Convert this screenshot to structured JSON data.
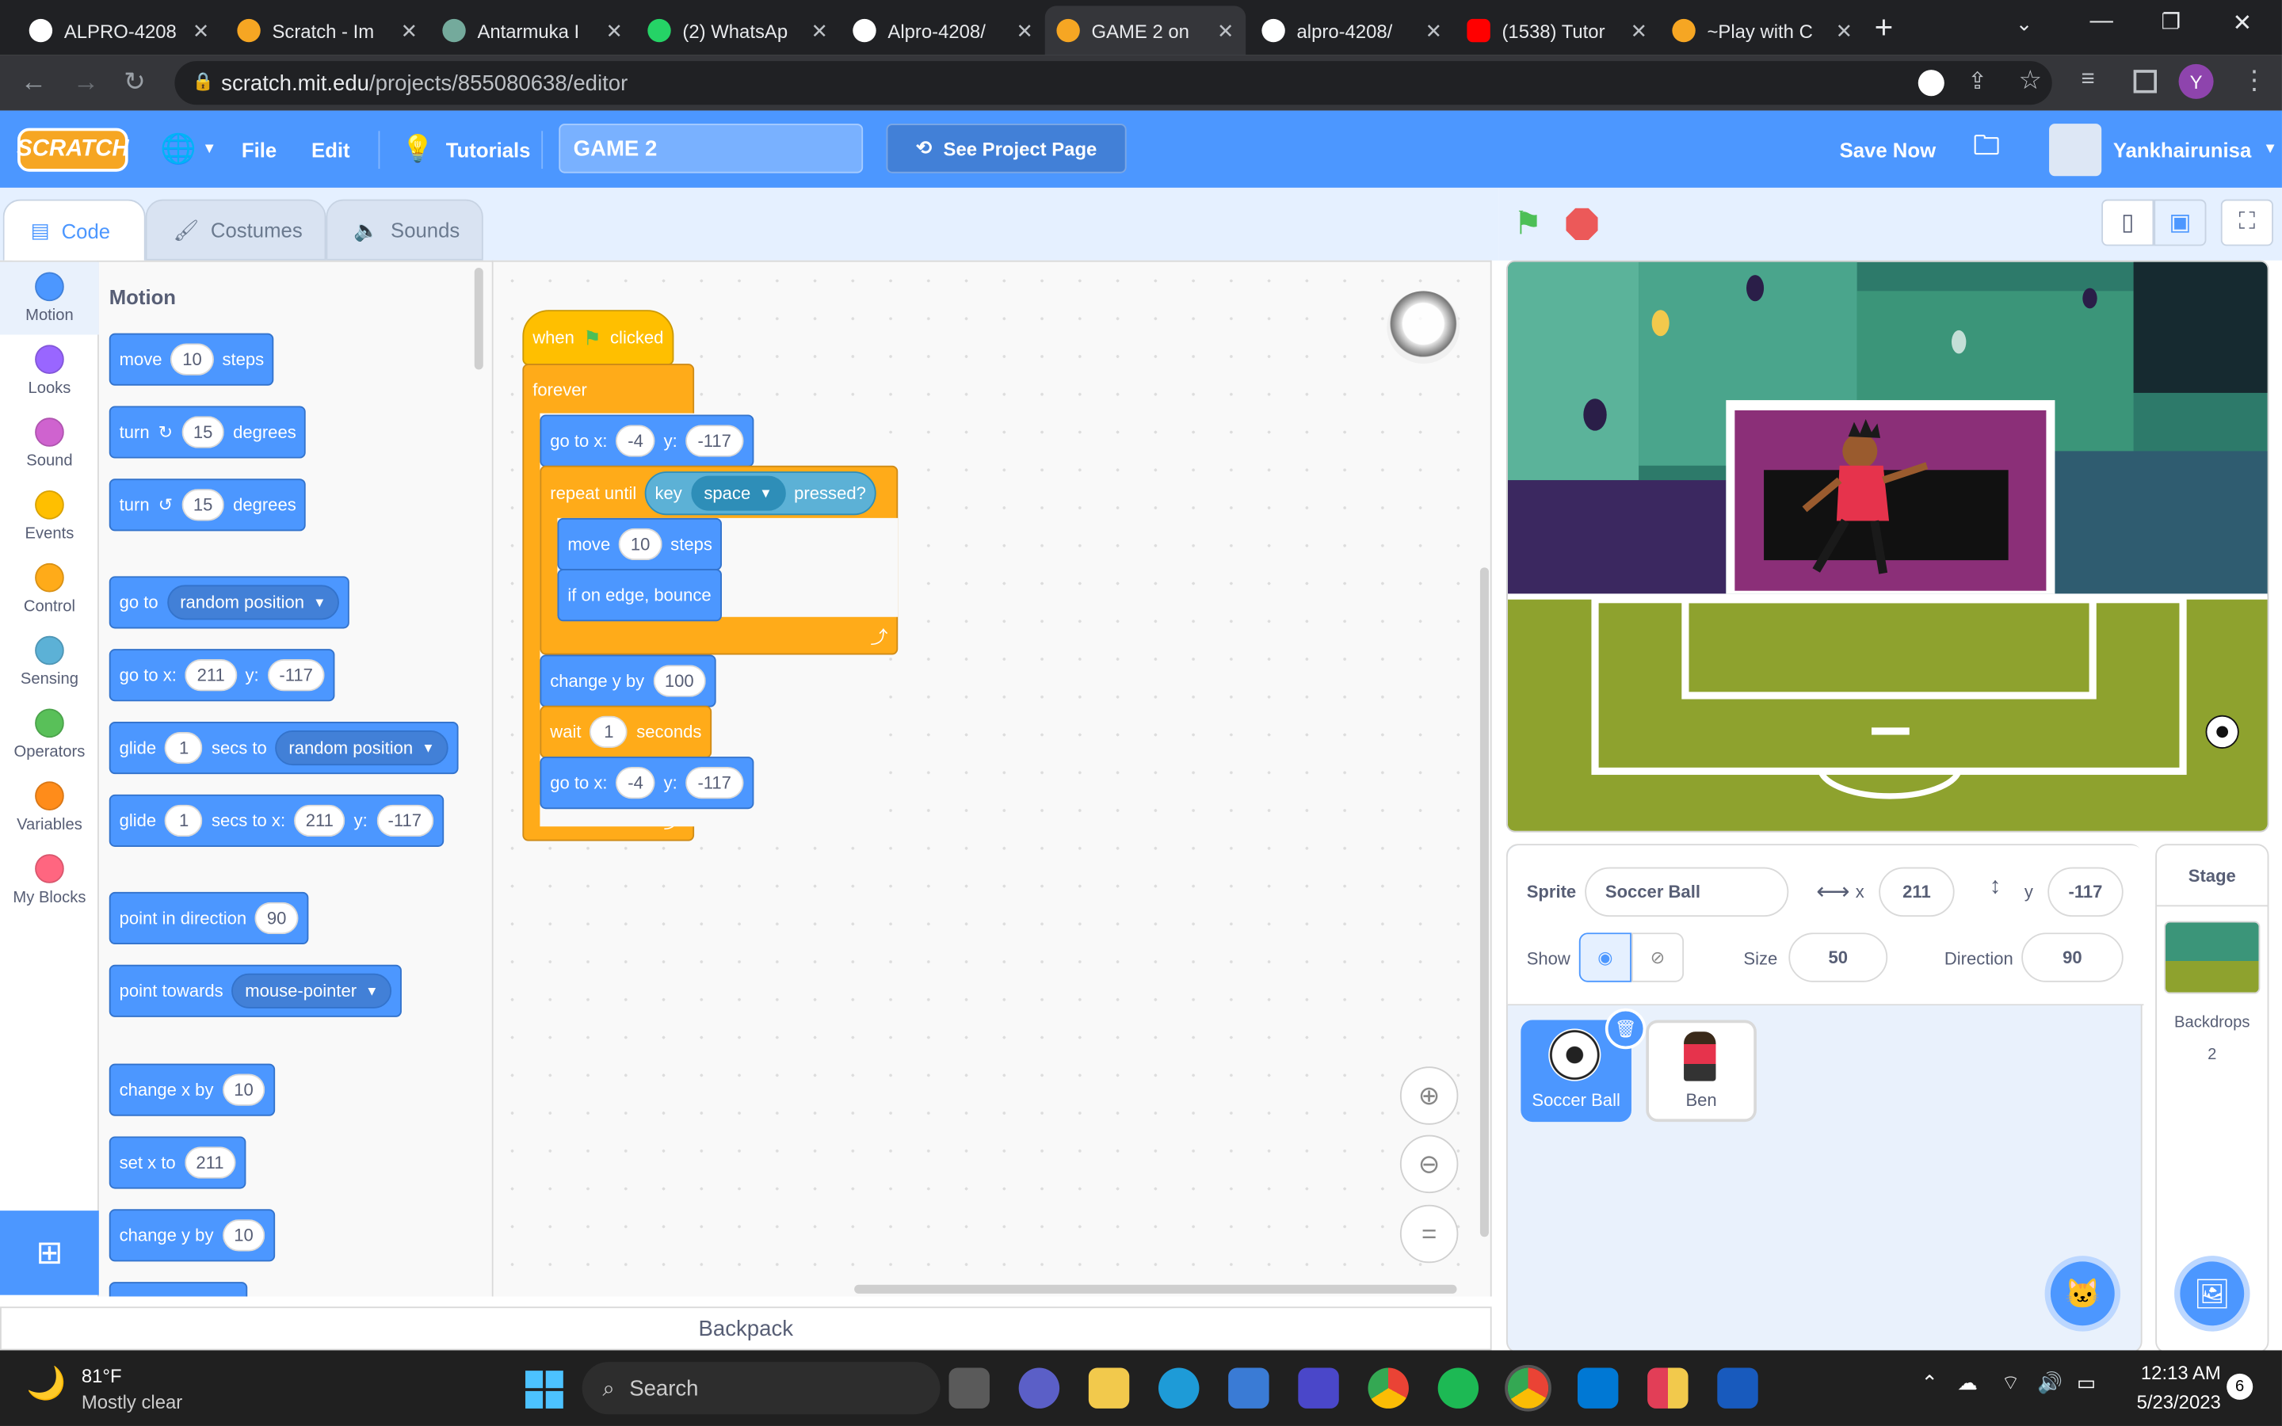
{
  "browser": {
    "tabs": [
      {
        "title": "ALPRO-4208",
        "icon": "github-icon",
        "color": "#ffffff"
      },
      {
        "title": "Scratch - Im",
        "icon": "scratch-icon",
        "color": "#f6a623"
      },
      {
        "title": "Antarmuka I",
        "icon": "chatgpt-icon",
        "color": "#74aa9c"
      },
      {
        "title": "(2) WhatsAp",
        "icon": "whatsapp-icon",
        "color": "#25d366"
      },
      {
        "title": "Alpro-4208/",
        "icon": "github-icon",
        "color": "#ffffff"
      },
      {
        "title": "GAME 2 on",
        "icon": "scratch-icon",
        "color": "#f6a623",
        "active": true
      },
      {
        "title": "alpro-4208/",
        "icon": "github-icon",
        "color": "#ffffff"
      },
      {
        "title": "(1538) Tutor",
        "icon": "youtube-icon",
        "color": "#ff0000"
      },
      {
        "title": "~Play with C",
        "icon": "scratch-icon",
        "color": "#f6a623"
      }
    ],
    "url_host": "scratch.mit.edu",
    "url_path": "/projects/855080638/editor",
    "profile_initial": "Y"
  },
  "menu": {
    "logo": "SCRATCH",
    "file": "File",
    "edit": "Edit",
    "tutorials": "Tutorials",
    "project_title": "GAME 2",
    "see_project": "See Project Page",
    "save_now": "Save Now",
    "username": "Yankhairunisa"
  },
  "editor_tabs": {
    "code": "Code",
    "costumes": "Costumes",
    "sounds": "Sounds"
  },
  "categories": [
    {
      "label": "Motion",
      "color": "#4c97ff"
    },
    {
      "label": "Looks",
      "color": "#9966ff"
    },
    {
      "label": "Sound",
      "color": "#cf63cf"
    },
    {
      "label": "Events",
      "color": "#ffbf00"
    },
    {
      "label": "Control",
      "color": "#ffab19"
    },
    {
      "label": "Sensing",
      "color": "#5cb1d6"
    },
    {
      "label": "Operators",
      "color": "#59c059"
    },
    {
      "label": "Variables",
      "color": "#ff8c1a"
    },
    {
      "label": "My Blocks",
      "color": "#ff6680"
    }
  ],
  "palette": {
    "heading": "Motion",
    "move": {
      "a": "move",
      "v": "10",
      "b": "steps"
    },
    "turn_right": {
      "a": "turn",
      "v": "15",
      "b": "degrees"
    },
    "turn_left": {
      "a": "turn",
      "v": "15",
      "b": "degrees"
    },
    "goto": {
      "a": "go to",
      "dd": "random position"
    },
    "gotoxy": {
      "a": "go to x:",
      "x": "211",
      "b": "y:",
      "y": "-117"
    },
    "glide_to": {
      "a": "glide",
      "v": "1",
      "b": "secs to",
      "dd": "random position"
    },
    "glide_xy": {
      "a": "glide",
      "v": "1",
      "b": "secs to x:",
      "x": "211",
      "c": "y:",
      "y": "-117"
    },
    "point_dir": {
      "a": "point in direction",
      "v": "90"
    },
    "point_towards": {
      "a": "point towards",
      "dd": "mouse-pointer"
    },
    "change_x": {
      "a": "change x by",
      "v": "10"
    },
    "set_x": {
      "a": "set x to",
      "v": "211"
    },
    "change_y": {
      "a": "change y by",
      "v": "10"
    }
  },
  "script": {
    "hat": {
      "a": "when",
      "b": "clicked"
    },
    "forever": "forever",
    "goto1": {
      "a": "go to x:",
      "x": "-4",
      "b": "y:",
      "y": "-117"
    },
    "repeat_until": "repeat until",
    "key": {
      "a": "key",
      "dd": "space",
      "b": "pressed?"
    },
    "move": {
      "a": "move",
      "v": "10",
      "b": "steps"
    },
    "bounce": "if on edge, bounce",
    "change_y": {
      "a": "change y by",
      "v": "100"
    },
    "wait": {
      "a": "wait",
      "v": "1",
      "b": "seconds"
    },
    "goto2": {
      "a": "go to x:",
      "x": "-4",
      "b": "y:",
      "y": "-117"
    }
  },
  "backpack": "Backpack",
  "sprite_info": {
    "sprite_label": "Sprite",
    "sprite_name": "Soccer Ball",
    "x_label": "x",
    "x": "211",
    "y_label": "y",
    "y": "-117",
    "show_label": "Show",
    "size_label": "Size",
    "size": "50",
    "direction_label": "Direction",
    "direction": "90"
  },
  "sprites": [
    {
      "name": "Soccer Ball",
      "selected": true
    },
    {
      "name": "Ben",
      "selected": false
    }
  ],
  "stage_panel": {
    "title": "Stage",
    "backdrops_label": "Backdrops",
    "backdrops_count": "2"
  },
  "taskbar": {
    "temp": "81°F",
    "weather": "Mostly clear",
    "search": "Search",
    "time": "12:13 AM",
    "date": "5/23/2023",
    "notif": "6"
  }
}
